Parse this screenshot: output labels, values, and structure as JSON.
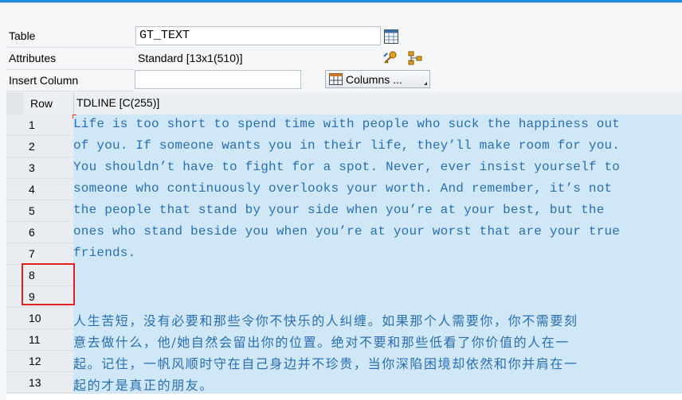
{
  "form": {
    "table_label": "Table",
    "table_value": "GT_TEXT",
    "attributes_label": "Attributes",
    "attributes_value": "Standard [13x1(510)]",
    "insert_column_label": "Insert Column",
    "insert_column_value": "",
    "columns_button": "Columns ..."
  },
  "grid": {
    "row_header": "Row",
    "column_header": "TDLINE [C(255)]",
    "rows": [
      {
        "num": "1",
        "text": "Life is too short to spend time with people who suck the happiness out"
      },
      {
        "num": "2",
        "text": "of you. If someone wants you in their life, they’ll make room for you."
      },
      {
        "num": "3",
        "text": "You shouldn’t have to fight for a spot. Never, ever insist yourself to"
      },
      {
        "num": "4",
        "text": "someone who continuously overlooks your worth. And remember, it’s not"
      },
      {
        "num": "5",
        "text": "the people that stand by your side when you’re at your best, but the"
      },
      {
        "num": "6",
        "text": "ones who stand beside you when you’re at your worst that are your true"
      },
      {
        "num": "7",
        "text": "friends."
      },
      {
        "num": "8",
        "text": ""
      },
      {
        "num": "9",
        "text": ""
      },
      {
        "num": "10",
        "text": "人生苦短，没有必要和那些令你不快乐的人纠缠。如果那个人需要你，你不需要刻"
      },
      {
        "num": "11",
        "text": "意去做什么，他/她自然会留出你的位置。绝对不要和那些低看了你价值的人在一"
      },
      {
        "num": "12",
        "text": "起。记住，一帆风顺时守在自己身边并不珍贵，当你深陷困境却依然和你并肩在一"
      },
      {
        "num": "13",
        "text": "起的才是真正的朋友。"
      }
    ]
  },
  "icons": [
    "table-view-icon",
    "key-settings-icon",
    "hierarchy-icon",
    "grid-columns-icon"
  ],
  "colors": {
    "accent": "#1e8ad8",
    "selected_row": "#cfe7f6",
    "text": "#2a6fb0",
    "highlight": "#e02020"
  }
}
